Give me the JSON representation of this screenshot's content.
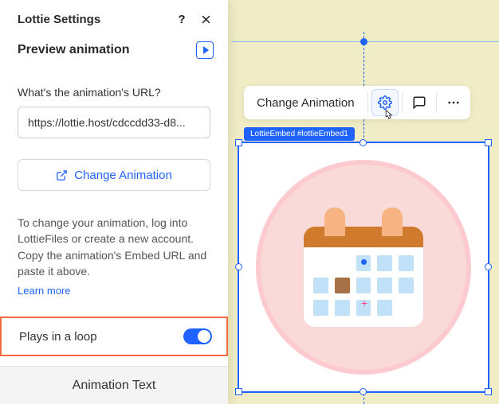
{
  "panel": {
    "title": "Lottie Settings",
    "preview_label": "Preview animation",
    "url_question": "What's the animation's URL?",
    "url_value": "https://lottie.host/cdccdd33-d8...",
    "change_btn_label": "Change Animation",
    "help_text": "To change your animation, log into LottieFiles or create a new account. Copy the animation's Embed URL and paste it above.",
    "learn_more": "Learn more",
    "loop_label": "Plays in a loop",
    "animation_text_label": "Animation Text"
  },
  "toolbar": {
    "change_label": "Change Animation"
  },
  "embed_label": "LottieEmbed #lottieEmbed1"
}
